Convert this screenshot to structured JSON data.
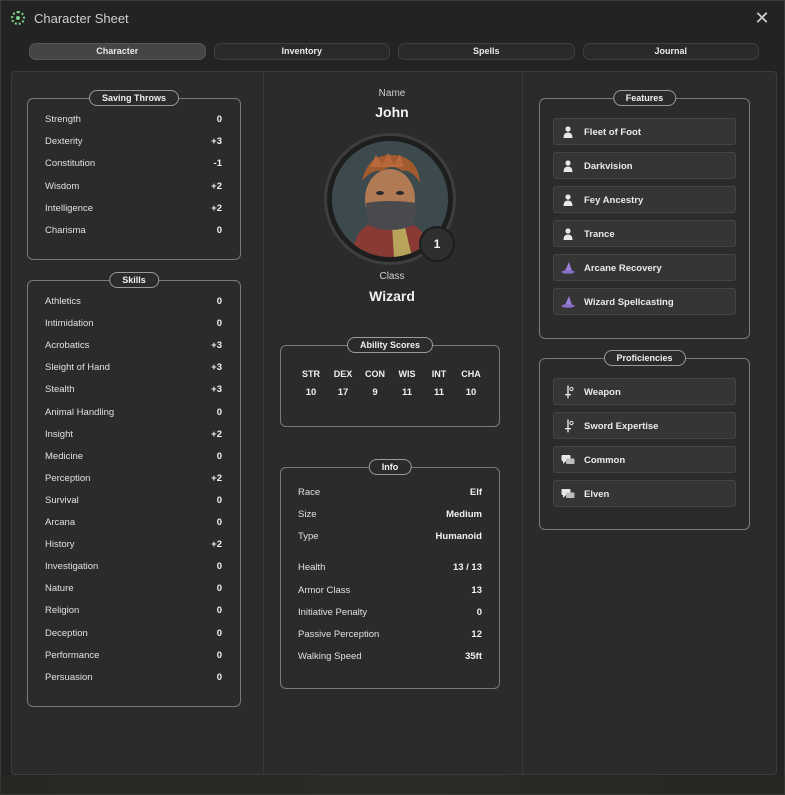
{
  "window": {
    "title": "Character Sheet",
    "close_glyph": "✕"
  },
  "tabs": [
    {
      "label": "Character",
      "active": true
    },
    {
      "label": "Inventory",
      "active": false
    },
    {
      "label": "Spells",
      "active": false
    },
    {
      "label": "Journal",
      "active": false
    }
  ],
  "saving_throws": {
    "title": "Saving Throws",
    "rows": [
      {
        "name": "Strength",
        "value": "0"
      },
      {
        "name": "Dexterity",
        "value": "+3"
      },
      {
        "name": "Constitution",
        "value": "-1"
      },
      {
        "name": "Wisdom",
        "value": "+2"
      },
      {
        "name": "Intelligence",
        "value": "+2"
      },
      {
        "name": "Charisma",
        "value": "0"
      }
    ]
  },
  "skills": {
    "title": "Skills",
    "rows": [
      {
        "name": "Athletics",
        "value": "0"
      },
      {
        "name": "Intimidation",
        "value": "0"
      },
      {
        "name": "Acrobatics",
        "value": "+3"
      },
      {
        "name": "Sleight of Hand",
        "value": "+3"
      },
      {
        "name": "Stealth",
        "value": "+3"
      },
      {
        "name": "Animal Handling",
        "value": "0"
      },
      {
        "name": "Insight",
        "value": "+2"
      },
      {
        "name": "Medicine",
        "value": "0"
      },
      {
        "name": "Perception",
        "value": "+2"
      },
      {
        "name": "Survival",
        "value": "0"
      },
      {
        "name": "Arcana",
        "value": "0"
      },
      {
        "name": "History",
        "value": "+2"
      },
      {
        "name": "Investigation",
        "value": "0"
      },
      {
        "name": "Nature",
        "value": "0"
      },
      {
        "name": "Religion",
        "value": "0"
      },
      {
        "name": "Deception",
        "value": "0"
      },
      {
        "name": "Performance",
        "value": "0"
      },
      {
        "name": "Persuasion",
        "value": "0"
      }
    ]
  },
  "character": {
    "name_label": "Name",
    "name": "John",
    "level": "1",
    "class_label": "Class",
    "class": "Wizard"
  },
  "ability_scores": {
    "title": "Ability Scores",
    "items": [
      {
        "abbr": "STR",
        "value": "10"
      },
      {
        "abbr": "DEX",
        "value": "17"
      },
      {
        "abbr": "CON",
        "value": "9"
      },
      {
        "abbr": "WIS",
        "value": "11"
      },
      {
        "abbr": "INT",
        "value": "11"
      },
      {
        "abbr": "CHA",
        "value": "10"
      }
    ]
  },
  "info": {
    "title": "Info",
    "rows": [
      {
        "name": "Race",
        "value": "Elf"
      },
      {
        "name": "Size",
        "value": "Medium"
      },
      {
        "name": "Type",
        "value": "Humanoid"
      },
      {
        "name": "Health",
        "value": "13 / 13"
      },
      {
        "name": "Armor Class",
        "value": "13"
      },
      {
        "name": "Initiative Penalty",
        "value": "0"
      },
      {
        "name": "Passive Perception",
        "value": "12"
      },
      {
        "name": "Walking Speed",
        "value": "35ft"
      }
    ]
  },
  "features": {
    "title": "Features",
    "items": [
      {
        "label": "Fleet of Foot",
        "icon": "person-icon"
      },
      {
        "label": "Darkvision",
        "icon": "person-icon"
      },
      {
        "label": "Fey Ancestry",
        "icon": "person-icon"
      },
      {
        "label": "Trance",
        "icon": "person-icon"
      },
      {
        "label": "Arcane Recovery",
        "icon": "wizard-hat-icon"
      },
      {
        "label": "Wizard Spellcasting",
        "icon": "wizard-hat-icon"
      }
    ]
  },
  "proficiencies": {
    "title": "Proficiencies",
    "items": [
      {
        "label": "Weapon",
        "icon": "sword-icon"
      },
      {
        "label": "Sword Expertise",
        "icon": "sword-icon"
      },
      {
        "label": "Common",
        "icon": "speech-icon"
      },
      {
        "label": "Elven",
        "icon": "speech-icon"
      }
    ]
  },
  "colors": {
    "background": "#232323",
    "panel": "#2b2b2b",
    "accent_purple": "#9b7fd8",
    "accent_green": "#7fd38a"
  }
}
